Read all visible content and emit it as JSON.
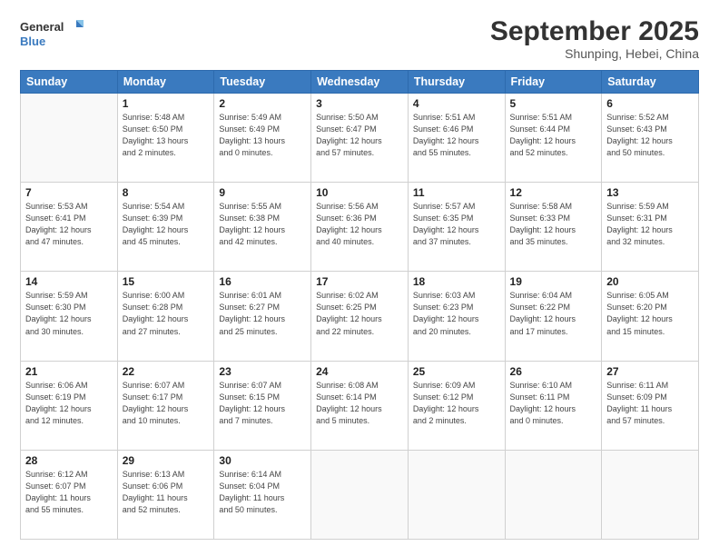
{
  "logo": {
    "line1": "General",
    "line2": "Blue"
  },
  "header": {
    "month": "September 2025",
    "location": "Shunping, Hebei, China"
  },
  "weekdays": [
    "Sunday",
    "Monday",
    "Tuesday",
    "Wednesday",
    "Thursday",
    "Friday",
    "Saturday"
  ],
  "weeks": [
    [
      {
        "day": "",
        "info": ""
      },
      {
        "day": "1",
        "info": "Sunrise: 5:48 AM\nSunset: 6:50 PM\nDaylight: 13 hours\nand 2 minutes."
      },
      {
        "day": "2",
        "info": "Sunrise: 5:49 AM\nSunset: 6:49 PM\nDaylight: 13 hours\nand 0 minutes."
      },
      {
        "day": "3",
        "info": "Sunrise: 5:50 AM\nSunset: 6:47 PM\nDaylight: 12 hours\nand 57 minutes."
      },
      {
        "day": "4",
        "info": "Sunrise: 5:51 AM\nSunset: 6:46 PM\nDaylight: 12 hours\nand 55 minutes."
      },
      {
        "day": "5",
        "info": "Sunrise: 5:51 AM\nSunset: 6:44 PM\nDaylight: 12 hours\nand 52 minutes."
      },
      {
        "day": "6",
        "info": "Sunrise: 5:52 AM\nSunset: 6:43 PM\nDaylight: 12 hours\nand 50 minutes."
      }
    ],
    [
      {
        "day": "7",
        "info": "Sunrise: 5:53 AM\nSunset: 6:41 PM\nDaylight: 12 hours\nand 47 minutes."
      },
      {
        "day": "8",
        "info": "Sunrise: 5:54 AM\nSunset: 6:39 PM\nDaylight: 12 hours\nand 45 minutes."
      },
      {
        "day": "9",
        "info": "Sunrise: 5:55 AM\nSunset: 6:38 PM\nDaylight: 12 hours\nand 42 minutes."
      },
      {
        "day": "10",
        "info": "Sunrise: 5:56 AM\nSunset: 6:36 PM\nDaylight: 12 hours\nand 40 minutes."
      },
      {
        "day": "11",
        "info": "Sunrise: 5:57 AM\nSunset: 6:35 PM\nDaylight: 12 hours\nand 37 minutes."
      },
      {
        "day": "12",
        "info": "Sunrise: 5:58 AM\nSunset: 6:33 PM\nDaylight: 12 hours\nand 35 minutes."
      },
      {
        "day": "13",
        "info": "Sunrise: 5:59 AM\nSunset: 6:31 PM\nDaylight: 12 hours\nand 32 minutes."
      }
    ],
    [
      {
        "day": "14",
        "info": "Sunrise: 5:59 AM\nSunset: 6:30 PM\nDaylight: 12 hours\nand 30 minutes."
      },
      {
        "day": "15",
        "info": "Sunrise: 6:00 AM\nSunset: 6:28 PM\nDaylight: 12 hours\nand 27 minutes."
      },
      {
        "day": "16",
        "info": "Sunrise: 6:01 AM\nSunset: 6:27 PM\nDaylight: 12 hours\nand 25 minutes."
      },
      {
        "day": "17",
        "info": "Sunrise: 6:02 AM\nSunset: 6:25 PM\nDaylight: 12 hours\nand 22 minutes."
      },
      {
        "day": "18",
        "info": "Sunrise: 6:03 AM\nSunset: 6:23 PM\nDaylight: 12 hours\nand 20 minutes."
      },
      {
        "day": "19",
        "info": "Sunrise: 6:04 AM\nSunset: 6:22 PM\nDaylight: 12 hours\nand 17 minutes."
      },
      {
        "day": "20",
        "info": "Sunrise: 6:05 AM\nSunset: 6:20 PM\nDaylight: 12 hours\nand 15 minutes."
      }
    ],
    [
      {
        "day": "21",
        "info": "Sunrise: 6:06 AM\nSunset: 6:19 PM\nDaylight: 12 hours\nand 12 minutes."
      },
      {
        "day": "22",
        "info": "Sunrise: 6:07 AM\nSunset: 6:17 PM\nDaylight: 12 hours\nand 10 minutes."
      },
      {
        "day": "23",
        "info": "Sunrise: 6:07 AM\nSunset: 6:15 PM\nDaylight: 12 hours\nand 7 minutes."
      },
      {
        "day": "24",
        "info": "Sunrise: 6:08 AM\nSunset: 6:14 PM\nDaylight: 12 hours\nand 5 minutes."
      },
      {
        "day": "25",
        "info": "Sunrise: 6:09 AM\nSunset: 6:12 PM\nDaylight: 12 hours\nand 2 minutes."
      },
      {
        "day": "26",
        "info": "Sunrise: 6:10 AM\nSunset: 6:11 PM\nDaylight: 12 hours\nand 0 minutes."
      },
      {
        "day": "27",
        "info": "Sunrise: 6:11 AM\nSunset: 6:09 PM\nDaylight: 11 hours\nand 57 minutes."
      }
    ],
    [
      {
        "day": "28",
        "info": "Sunrise: 6:12 AM\nSunset: 6:07 PM\nDaylight: 11 hours\nand 55 minutes."
      },
      {
        "day": "29",
        "info": "Sunrise: 6:13 AM\nSunset: 6:06 PM\nDaylight: 11 hours\nand 52 minutes."
      },
      {
        "day": "30",
        "info": "Sunrise: 6:14 AM\nSunset: 6:04 PM\nDaylight: 11 hours\nand 50 minutes."
      },
      {
        "day": "",
        "info": ""
      },
      {
        "day": "",
        "info": ""
      },
      {
        "day": "",
        "info": ""
      },
      {
        "day": "",
        "info": ""
      }
    ]
  ]
}
